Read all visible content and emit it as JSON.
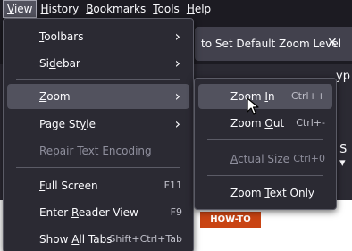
{
  "menubar": {
    "items": [
      {
        "accel": "V",
        "rest": "iew"
      },
      {
        "accel": "H",
        "rest": "istory"
      },
      {
        "accel": "B",
        "rest": "ookmarks"
      },
      {
        "accel": "T",
        "rest": "ools"
      },
      {
        "accel": "H",
        "rest": "elp"
      }
    ]
  },
  "background": {
    "tab_title": "to Set Default Zoom Level",
    "close_glyph": "✕",
    "url_fragment": "yp",
    "toolbar_fragment": "S ▾",
    "badge": "HOW-TO"
  },
  "view_menu": {
    "toolbars": {
      "pre": "",
      "accel": "T",
      "post": "oolbars"
    },
    "sidebar": {
      "pre": "Si",
      "accel": "d",
      "post": "ebar"
    },
    "zoom": {
      "pre": "",
      "accel": "Z",
      "post": "oom"
    },
    "page_style": {
      "pre": "Page St",
      "accel": "y",
      "post": "le"
    },
    "repair_encoding": "Repair Text Encoding",
    "full_screen": {
      "pre": "",
      "accel": "F",
      "post": "ull Screen"
    },
    "full_screen_shortcut": "F11",
    "reader_view": {
      "pre": "Enter ",
      "accel": "R",
      "post": "eader View"
    },
    "reader_view_shortcut": "F9",
    "show_all_tabs": {
      "pre": "Show ",
      "accel": "A",
      "post": "ll Tabs"
    },
    "show_all_tabs_shortcut": "Shift+Ctrl+Tab"
  },
  "zoom_menu": {
    "zoom_in": {
      "pre": "Zoom ",
      "accel": "I",
      "post": "n"
    },
    "zoom_in_shortcut": "Ctrl++",
    "zoom_out": {
      "pre": "Zoom ",
      "accel": "O",
      "post": "ut"
    },
    "zoom_out_shortcut": "Ctrl+-",
    "actual_size": {
      "pre": "",
      "accel": "A",
      "post": "ctual Size"
    },
    "actual_size_shortcut": "Ctrl+0",
    "zoom_text_only": {
      "pre": "Zoom ",
      "accel": "T",
      "post": "ext Only"
    }
  },
  "arrow_glyph": "›"
}
